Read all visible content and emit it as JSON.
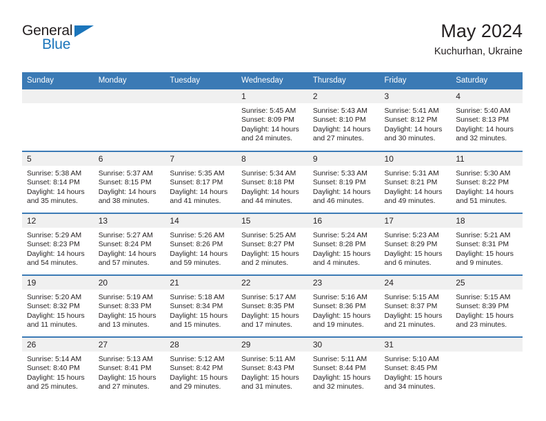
{
  "logo": {
    "top_text": "General",
    "bottom_text": "Blue",
    "triangle_icon": "triangle-icon",
    "brand_color": "#1b75bb"
  },
  "header": {
    "title": "May 2024",
    "subtitle": "Kuchurhan, Ukraine"
  },
  "theme": {
    "header_bg": "#3b7ab5",
    "header_text": "#ffffff",
    "daynum_bg": "#f0f0f0",
    "text": "#231f20"
  },
  "calendar": {
    "weekday_headers": [
      "Sunday",
      "Monday",
      "Tuesday",
      "Wednesday",
      "Thursday",
      "Friday",
      "Saturday"
    ],
    "weeks": [
      [
        {
          "day": "",
          "lines": []
        },
        {
          "day": "",
          "lines": []
        },
        {
          "day": "",
          "lines": []
        },
        {
          "day": "1",
          "lines": [
            "Sunrise: 5:45 AM",
            "Sunset: 8:09 PM",
            "Daylight: 14 hours",
            "and 24 minutes."
          ]
        },
        {
          "day": "2",
          "lines": [
            "Sunrise: 5:43 AM",
            "Sunset: 8:10 PM",
            "Daylight: 14 hours",
            "and 27 minutes."
          ]
        },
        {
          "day": "3",
          "lines": [
            "Sunrise: 5:41 AM",
            "Sunset: 8:12 PM",
            "Daylight: 14 hours",
            "and 30 minutes."
          ]
        },
        {
          "day": "4",
          "lines": [
            "Sunrise: 5:40 AM",
            "Sunset: 8:13 PM",
            "Daylight: 14 hours",
            "and 32 minutes."
          ]
        }
      ],
      [
        {
          "day": "5",
          "lines": [
            "Sunrise: 5:38 AM",
            "Sunset: 8:14 PM",
            "Daylight: 14 hours",
            "and 35 minutes."
          ]
        },
        {
          "day": "6",
          "lines": [
            "Sunrise: 5:37 AM",
            "Sunset: 8:15 PM",
            "Daylight: 14 hours",
            "and 38 minutes."
          ]
        },
        {
          "day": "7",
          "lines": [
            "Sunrise: 5:35 AM",
            "Sunset: 8:17 PM",
            "Daylight: 14 hours",
            "and 41 minutes."
          ]
        },
        {
          "day": "8",
          "lines": [
            "Sunrise: 5:34 AM",
            "Sunset: 8:18 PM",
            "Daylight: 14 hours",
            "and 44 minutes."
          ]
        },
        {
          "day": "9",
          "lines": [
            "Sunrise: 5:33 AM",
            "Sunset: 8:19 PM",
            "Daylight: 14 hours",
            "and 46 minutes."
          ]
        },
        {
          "day": "10",
          "lines": [
            "Sunrise: 5:31 AM",
            "Sunset: 8:21 PM",
            "Daylight: 14 hours",
            "and 49 minutes."
          ]
        },
        {
          "day": "11",
          "lines": [
            "Sunrise: 5:30 AM",
            "Sunset: 8:22 PM",
            "Daylight: 14 hours",
            "and 51 minutes."
          ]
        }
      ],
      [
        {
          "day": "12",
          "lines": [
            "Sunrise: 5:29 AM",
            "Sunset: 8:23 PM",
            "Daylight: 14 hours",
            "and 54 minutes."
          ]
        },
        {
          "day": "13",
          "lines": [
            "Sunrise: 5:27 AM",
            "Sunset: 8:24 PM",
            "Daylight: 14 hours",
            "and 57 minutes."
          ]
        },
        {
          "day": "14",
          "lines": [
            "Sunrise: 5:26 AM",
            "Sunset: 8:26 PM",
            "Daylight: 14 hours",
            "and 59 minutes."
          ]
        },
        {
          "day": "15",
          "lines": [
            "Sunrise: 5:25 AM",
            "Sunset: 8:27 PM",
            "Daylight: 15 hours",
            "and 2 minutes."
          ]
        },
        {
          "day": "16",
          "lines": [
            "Sunrise: 5:24 AM",
            "Sunset: 8:28 PM",
            "Daylight: 15 hours",
            "and 4 minutes."
          ]
        },
        {
          "day": "17",
          "lines": [
            "Sunrise: 5:23 AM",
            "Sunset: 8:29 PM",
            "Daylight: 15 hours",
            "and 6 minutes."
          ]
        },
        {
          "day": "18",
          "lines": [
            "Sunrise: 5:21 AM",
            "Sunset: 8:31 PM",
            "Daylight: 15 hours",
            "and 9 minutes."
          ]
        }
      ],
      [
        {
          "day": "19",
          "lines": [
            "Sunrise: 5:20 AM",
            "Sunset: 8:32 PM",
            "Daylight: 15 hours",
            "and 11 minutes."
          ]
        },
        {
          "day": "20",
          "lines": [
            "Sunrise: 5:19 AM",
            "Sunset: 8:33 PM",
            "Daylight: 15 hours",
            "and 13 minutes."
          ]
        },
        {
          "day": "21",
          "lines": [
            "Sunrise: 5:18 AM",
            "Sunset: 8:34 PM",
            "Daylight: 15 hours",
            "and 15 minutes."
          ]
        },
        {
          "day": "22",
          "lines": [
            "Sunrise: 5:17 AM",
            "Sunset: 8:35 PM",
            "Daylight: 15 hours",
            "and 17 minutes."
          ]
        },
        {
          "day": "23",
          "lines": [
            "Sunrise: 5:16 AM",
            "Sunset: 8:36 PM",
            "Daylight: 15 hours",
            "and 19 minutes."
          ]
        },
        {
          "day": "24",
          "lines": [
            "Sunrise: 5:15 AM",
            "Sunset: 8:37 PM",
            "Daylight: 15 hours",
            "and 21 minutes."
          ]
        },
        {
          "day": "25",
          "lines": [
            "Sunrise: 5:15 AM",
            "Sunset: 8:39 PM",
            "Daylight: 15 hours",
            "and 23 minutes."
          ]
        }
      ],
      [
        {
          "day": "26",
          "lines": [
            "Sunrise: 5:14 AM",
            "Sunset: 8:40 PM",
            "Daylight: 15 hours",
            "and 25 minutes."
          ]
        },
        {
          "day": "27",
          "lines": [
            "Sunrise: 5:13 AM",
            "Sunset: 8:41 PM",
            "Daylight: 15 hours",
            "and 27 minutes."
          ]
        },
        {
          "day": "28",
          "lines": [
            "Sunrise: 5:12 AM",
            "Sunset: 8:42 PM",
            "Daylight: 15 hours",
            "and 29 minutes."
          ]
        },
        {
          "day": "29",
          "lines": [
            "Sunrise: 5:11 AM",
            "Sunset: 8:43 PM",
            "Daylight: 15 hours",
            "and 31 minutes."
          ]
        },
        {
          "day": "30",
          "lines": [
            "Sunrise: 5:11 AM",
            "Sunset: 8:44 PM",
            "Daylight: 15 hours",
            "and 32 minutes."
          ]
        },
        {
          "day": "31",
          "lines": [
            "Sunrise: 5:10 AM",
            "Sunset: 8:45 PM",
            "Daylight: 15 hours",
            "and 34 minutes."
          ]
        },
        {
          "day": "",
          "lines": []
        }
      ]
    ]
  }
}
